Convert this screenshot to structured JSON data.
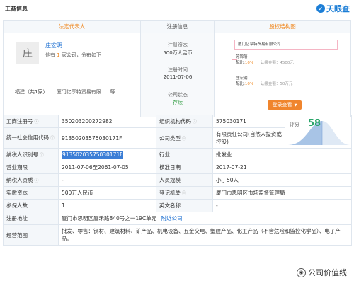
{
  "header": {
    "title": "工商信息",
    "brand": "天眼查",
    "brand_icon": "tianyancha-logo-icon"
  },
  "legal_rep": {
    "col_title": "法定代表人",
    "avatar_char": "庄",
    "name": "庄宏明",
    "sub_prefix": "他有",
    "company_count": "1",
    "sub_suffix": "家公司，分布如下",
    "region": "福建（共1家）",
    "company": "厦门亿享特贸易有限...",
    "company_more": "等"
  },
  "registration": {
    "col_title": "注册信息",
    "capital_label": "注册资本",
    "capital_value": "500万人民币",
    "time_label": "注册时间",
    "time_value": "2011-07-06",
    "status_label": "公司状态",
    "status_value": "存续"
  },
  "equity": {
    "col_title": "股权结构图",
    "company": "厦门亿享特贸易有限公司",
    "holders": [
      {
        "name": "苏锦藩",
        "pct_label": "配比:",
        "pct": "10%",
        "amt": "认缴金额：4500元"
      },
      {
        "name": "庄宏明",
        "pct_label": "配比:",
        "pct": "10%",
        "amt": "认缴金额：50万元"
      }
    ],
    "more_button": "登录查看",
    "more_icon": "download-arrow-icon"
  },
  "score": {
    "label": "评分",
    "value": "58"
  },
  "table": [
    {
      "k1": "工商注册号",
      "v1": "350203200272982",
      "k2": "组织机构代码",
      "v2": "575030171"
    },
    {
      "k1": "统一社会信用代码",
      "v1": "91350203575030171F",
      "k2": "公司类型",
      "v2": "有限责任公司(自然人投资或控股)"
    },
    {
      "k1": "纳税人识别号",
      "v1": "91350203575030171F",
      "k2": "行业",
      "v2": "批发业"
    },
    {
      "k1": "营业期限",
      "v1": "2011-07-06至2061-07-05",
      "k2": "核准日期",
      "v2": "2017-07-21"
    },
    {
      "k1": "纳税人资质",
      "v1": "-",
      "k2": "人员规模",
      "v2": "小于50人"
    },
    {
      "k1": "实缴资本",
      "v1": "500万人民币",
      "k2": "登记机关",
      "v2": "厦门市思明区市场监督管理局"
    },
    {
      "k1": "参保人数",
      "v1": "1",
      "k2": "英文名称",
      "v2": "-"
    }
  ],
  "address": {
    "label": "注册地址",
    "value": "厦门市思明区厦禾路840号之一19C单元",
    "link": "附近公司"
  },
  "scope": {
    "label": "经营范围",
    "value": "批发、零售：钢材、建筑材料、矿产品、机电设备、五金交电、塑胶产品、化工产品（不含危险和监控化学品）、电子产品。"
  },
  "watermark": {
    "icon": "wechat-account-icon",
    "text": "公司价值线"
  }
}
